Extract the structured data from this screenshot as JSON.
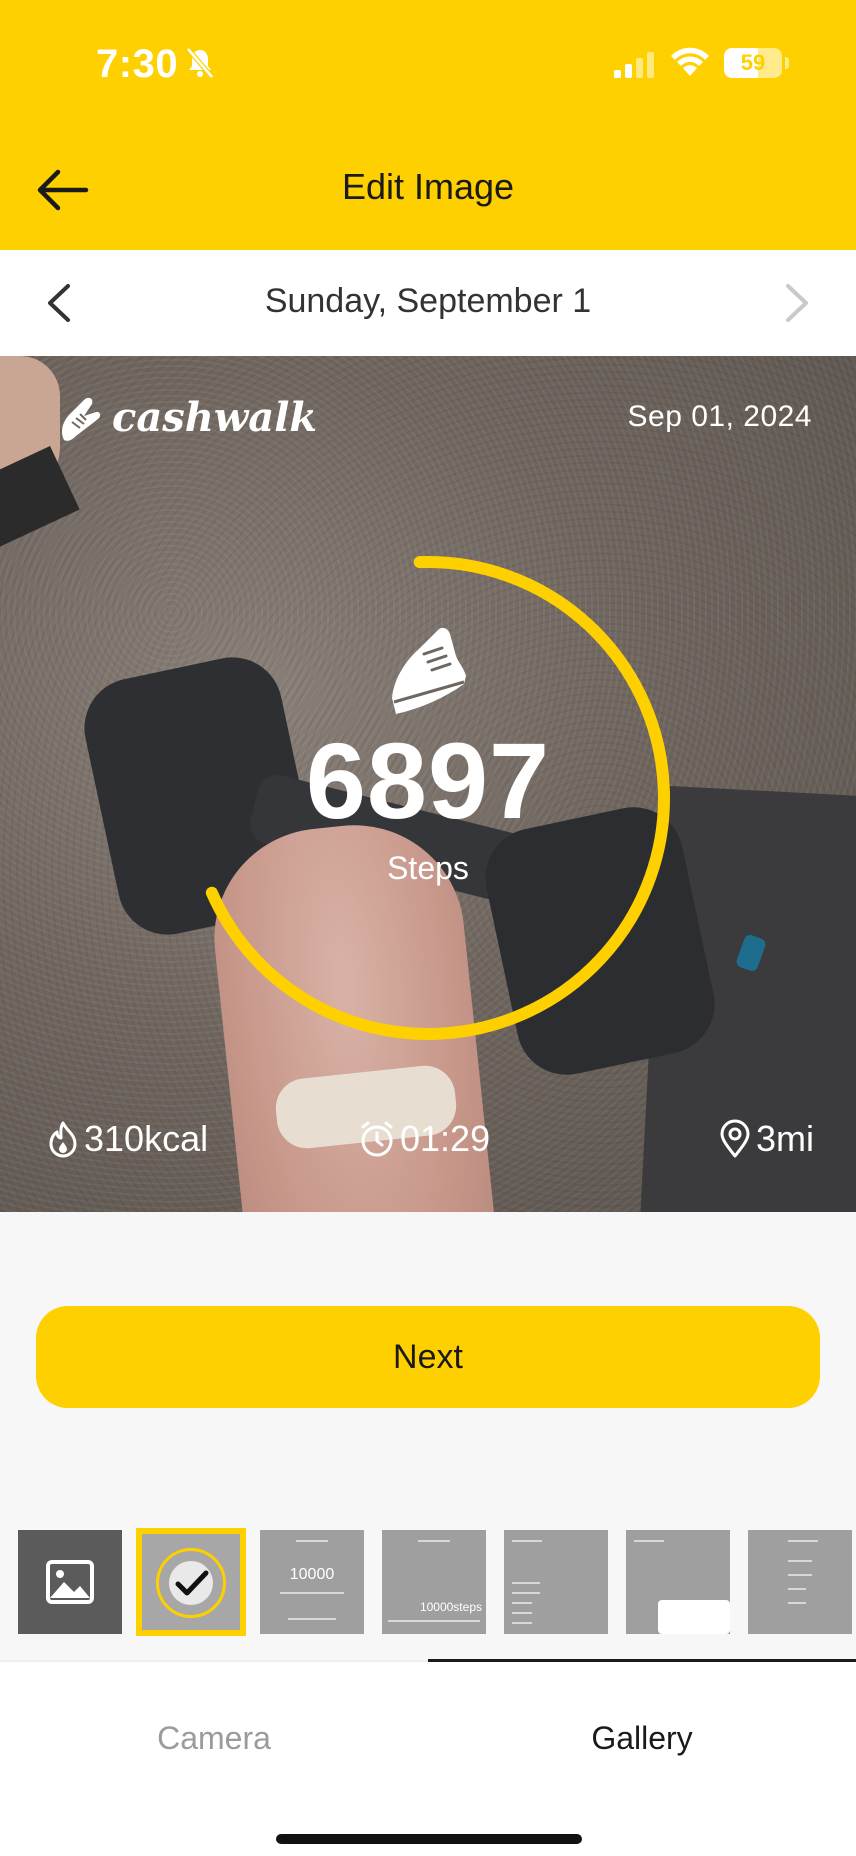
{
  "status_bar": {
    "time": "7:30",
    "battery": "59",
    "battery_level": 0.59
  },
  "header": {
    "title": "Edit Image",
    "back_icon": "arrow-left-icon",
    "bg_color": "#FFD000"
  },
  "date_nav": {
    "label": "Sunday, September 1"
  },
  "card": {
    "brand": "cashwalk",
    "date": "Sep 01, 2024",
    "steps": "6897",
    "steps_label": "Steps",
    "progress": 0.6897,
    "ring_color": "#FFD000",
    "stats": [
      {
        "icon": "flame-icon",
        "value": "310kcal"
      },
      {
        "icon": "stopwatch-icon",
        "value": "01:29"
      },
      {
        "icon": "location-pin-icon",
        "value": "3mi"
      }
    ]
  },
  "next_button": {
    "label": "Next"
  },
  "templates": [
    {
      "kind": "gallery",
      "icon": "image-icon"
    },
    {
      "kind": "selected",
      "icon": "checkmark-icon"
    },
    {
      "kind": "big-number",
      "text": "10000"
    },
    {
      "kind": "steps-bottom",
      "text": "10000steps"
    },
    {
      "kind": "list"
    },
    {
      "kind": "card-bottom"
    },
    {
      "kind": "list-right"
    }
  ],
  "tabs": [
    {
      "label": "Camera",
      "active": false
    },
    {
      "label": "Gallery",
      "active": true
    }
  ]
}
